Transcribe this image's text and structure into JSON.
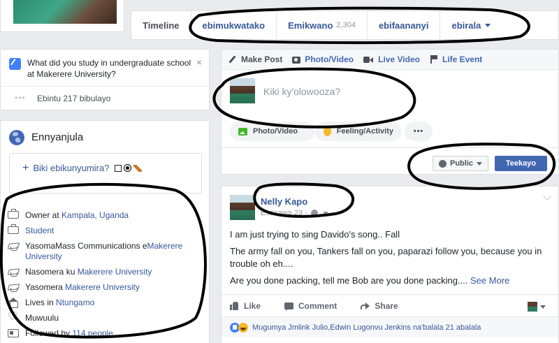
{
  "profile": {
    "tabs": [
      {
        "label": "Timeline",
        "count": ""
      },
      {
        "label": "ebimukwatako",
        "count": ""
      },
      {
        "label": "Emikwano",
        "count": "2,304"
      },
      {
        "label": "ebifaananyi",
        "count": ""
      },
      {
        "label": "ebirala",
        "count": ""
      }
    ]
  },
  "question_card": {
    "text": "What did you study in undergraduate school at Makerere University?",
    "close": "×",
    "dots": "•••",
    "pages": "Ebintu 217 bibulayo"
  },
  "intro": {
    "title": "Ennyanjula",
    "featured_add": "Biki ebikunyumira?",
    "items": [
      {
        "icon": "briefcase-icon",
        "prefix": "Owner at ",
        "link": "Kampala, Uganda",
        "suffix": ""
      },
      {
        "icon": "briefcase-icon",
        "prefix": "",
        "link": "Student",
        "suffix": ""
      },
      {
        "icon": "graduation-cap-icon",
        "prefix": "YasomaMass Communications e",
        "link": "Makerere University",
        "suffix": ""
      },
      {
        "icon": "graduation-cap-icon",
        "prefix": "Nasomera ku ",
        "link": "Makerere University",
        "suffix": ""
      },
      {
        "icon": "graduation-cap-icon",
        "prefix": "Yasomera ",
        "link": "Makerere University",
        "suffix": ""
      },
      {
        "icon": "home-icon",
        "prefix": "Lives in ",
        "link": "Ntungamo",
        "suffix": ""
      },
      {
        "icon": "heart-icon",
        "prefix": "Muwuulu",
        "link": "",
        "suffix": ""
      },
      {
        "icon": "followers-icon",
        "prefix": "Followed by ",
        "link": "114 people",
        "suffix": ""
      }
    ]
  },
  "composer": {
    "tabs": [
      "Make Post",
      "Photo/Video",
      "Live Video",
      "Life Event"
    ],
    "placeholder": "Kiki ky'olowooza?",
    "pill_photo": "Photo/Video",
    "pill_feeling": "Feeling/Activity",
    "pill_more": "•••",
    "audience": "Public",
    "post_button": "Teekayo"
  },
  "post": {
    "author": "Nelly Kapo",
    "time": "Essaawa 23 ·",
    "paragraphs": [
      "I am just trying to sing Davido's song.. Fall",
      "The army fall on you, Tankers fall on you, paparazi follow you, because you in trouble oh eh....",
      "Are you done packing, tell me Bob are you done packing...."
    ],
    "see_more": "See More",
    "actions": [
      "Like",
      "Comment",
      "Share"
    ],
    "reactions_text": "Mugumya Jmlink Julio,Edwin Lugonvu Jenkins na'balala 21 abalala"
  },
  "colors": {
    "brand": "#4267b2",
    "link": "#365899",
    "background": "#e9ebee"
  }
}
